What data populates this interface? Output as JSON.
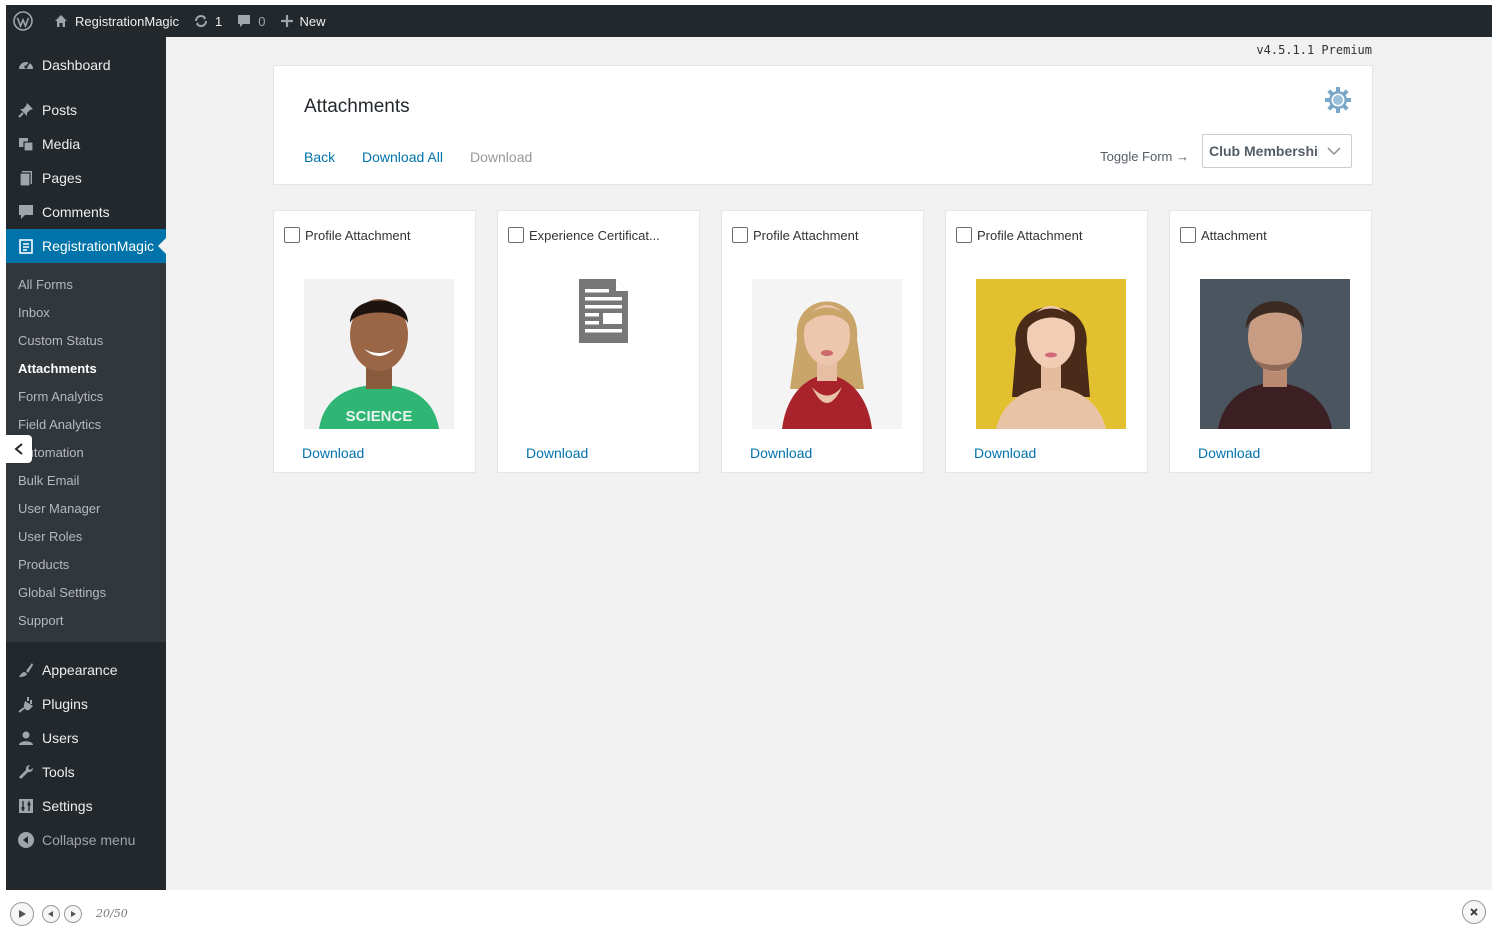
{
  "admin_bar": {
    "site_name": "RegistrationMagic",
    "updates_count": "1",
    "comments_count": "0",
    "new_label": "New"
  },
  "sidebar": {
    "top_items": [
      {
        "label": "Dashboard",
        "icon": "dashboard-icon"
      },
      {
        "label": "Posts",
        "icon": "pin-icon"
      },
      {
        "label": "Media",
        "icon": "media-icon"
      },
      {
        "label": "Pages",
        "icon": "pages-icon"
      },
      {
        "label": "Comments",
        "icon": "comments-icon"
      },
      {
        "label": "RegistrationMagic",
        "icon": "form-icon"
      }
    ],
    "submenu": [
      "All Forms",
      "Inbox",
      "Custom Status",
      "Attachments",
      "Form Analytics",
      "Field Analytics",
      "Automation",
      "Bulk Email",
      "User Manager",
      "User Roles",
      "Products",
      "Global Settings",
      "Support"
    ],
    "bottom_items": [
      {
        "label": "Appearance",
        "icon": "brush-icon"
      },
      {
        "label": "Plugins",
        "icon": "plug-icon"
      },
      {
        "label": "Users",
        "icon": "user-icon"
      },
      {
        "label": "Tools",
        "icon": "wrench-icon"
      },
      {
        "label": "Settings",
        "icon": "settings-icon"
      }
    ],
    "collapse_label": "Collapse menu"
  },
  "version": "v4.5.1.1 Premium",
  "header": {
    "title": "Attachments",
    "back_label": "Back",
    "download_all_label": "Download All",
    "download_label": "Download",
    "toggle_form_label": "Toggle Form →",
    "form_select_value": "Club Membership"
  },
  "attachments": [
    {
      "label": "Profile Attachment",
      "download": "Download",
      "type": "photo"
    },
    {
      "label": "Experience Certificat...",
      "download": "Download",
      "type": "document"
    },
    {
      "label": "Profile Attachment",
      "download": "Download",
      "type": "photo"
    },
    {
      "label": "Profile Attachment",
      "download": "Download",
      "type": "photo"
    },
    {
      "label": "Attachment",
      "download": "Download",
      "type": "photo"
    }
  ],
  "player": {
    "counter": "20/50"
  },
  "colors": {
    "admin_bg": "#23282d",
    "accent": "#0073aa",
    "submenu_bg": "#32373c",
    "content_bg": "#f1f1f1"
  }
}
